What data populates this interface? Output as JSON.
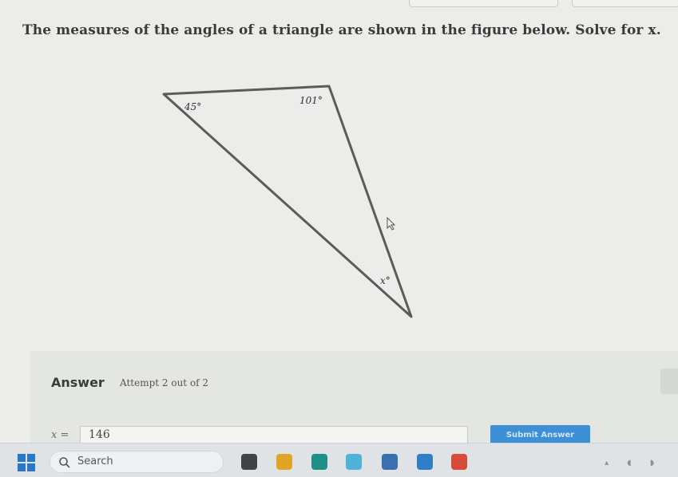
{
  "question": {
    "text": "The measures of the angles of a triangle are shown in the figure below. Solve for x."
  },
  "figure": {
    "angles": [
      "45°",
      "101°",
      "x°"
    ]
  },
  "answer": {
    "title": "Answer",
    "attempt": "Attempt 2 out of 2",
    "variable_label": "x =",
    "input_value": "146",
    "submit_label": "Submit Answer"
  },
  "taskbar": {
    "search_label": "Search",
    "apps": [
      {
        "icon": "file-explorer-icon",
        "color": "#3f4448"
      },
      {
        "icon": "folder-icon",
        "color": "#e0a526"
      },
      {
        "icon": "edge-icon",
        "color": "#1f8f8a"
      },
      {
        "icon": "photos-icon",
        "color": "#4fb3d9"
      },
      {
        "icon": "store-icon",
        "color": "#3a6fb0"
      },
      {
        "icon": "mail-icon",
        "color": "#2f7fc8"
      },
      {
        "icon": "chrome-icon",
        "color": "#d84a3a"
      }
    ]
  }
}
